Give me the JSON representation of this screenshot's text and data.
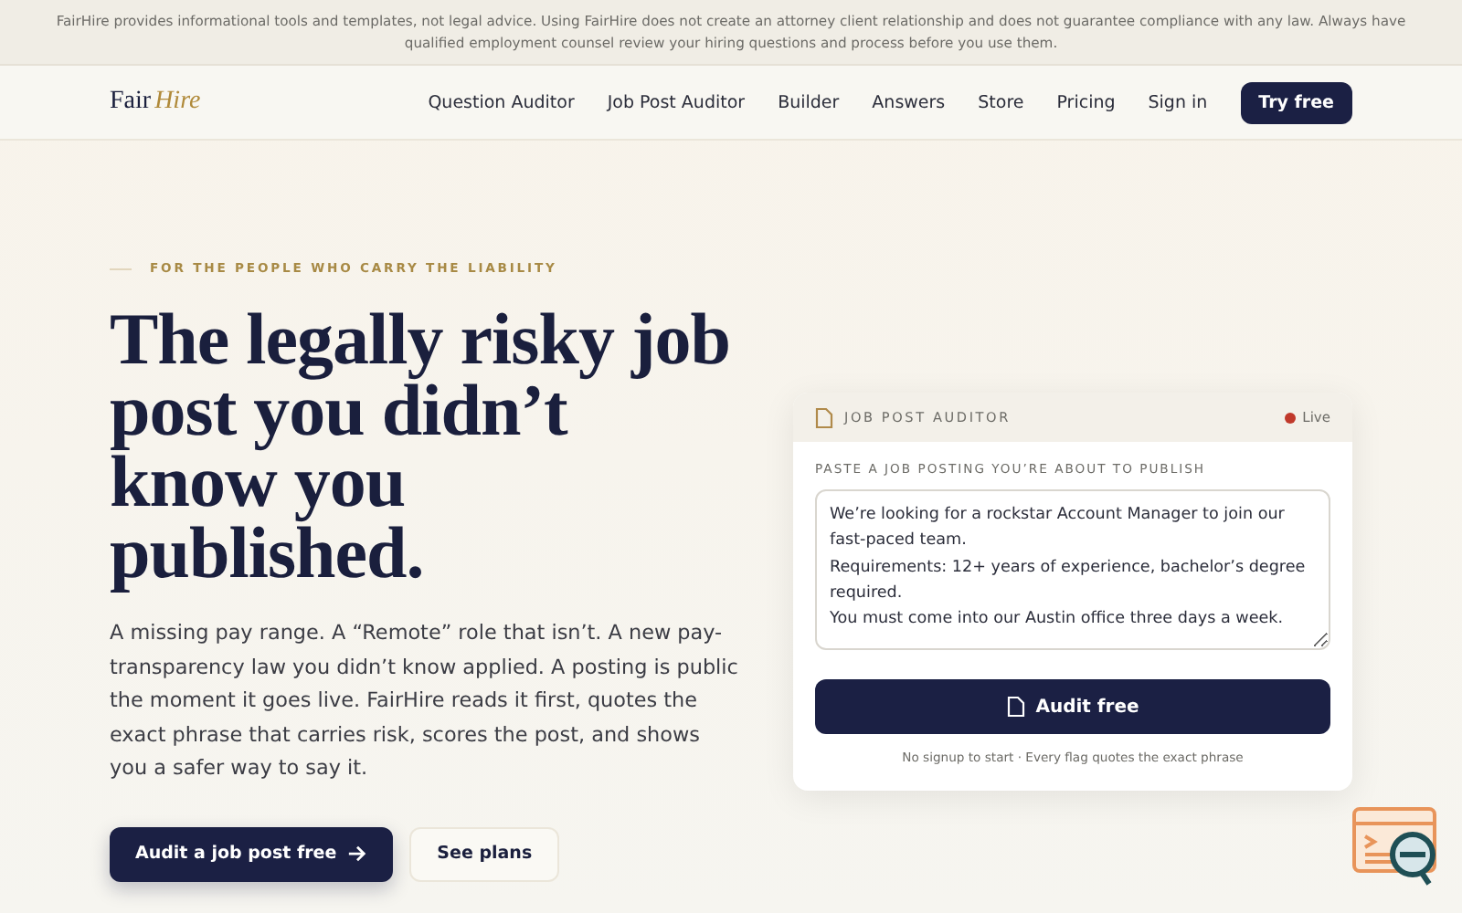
{
  "disclaimer": "FairHire provides informational tools and templates, not legal advice. Using FairHire does not create an attorney client relationship and does not guarantee compliance with any law. Always have qualified employment counsel review your hiring questions and process before you use them.",
  "logo": {
    "first": "Fair",
    "second": "Hire"
  },
  "nav": [
    "Question Auditor",
    "Job Post Auditor",
    "Builder",
    "Answers",
    "Store",
    "Pricing",
    "Sign in"
  ],
  "nav_cta": "Try free",
  "hero": {
    "eyebrow": "FOR THE PEOPLE WHO CARRY THE LIABILITY",
    "headline": "The legally risky job post you didn’t know you published.",
    "body": "A missing pay range. A “Remote” role that isn’t. A new pay-transparency law you didn’t know applied. A posting is public the moment it goes live. FairHire reads it first, quotes the exact phrase that carries risk, scores the post, and shows you a safer way to say it.",
    "primary": "Audit a job post free",
    "secondary": "See plans"
  },
  "card": {
    "title": "JOB POST AUDITOR",
    "status": "Live",
    "live": true,
    "field_label": "PASTE A JOB POSTING YOU’RE ABOUT TO PUBLISH",
    "value": "We’re looking for a rockstar Account Manager to join our fast-paced team.\nRequirements: 12+ years of experience, bachelor’s degree required.\nYou must come into our Austin office three days a week.",
    "button": "Audit free",
    "note": "No signup to start · Every flag quotes the exact phrase"
  }
}
